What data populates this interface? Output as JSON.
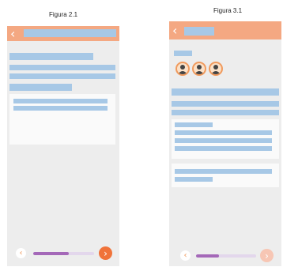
{
  "captions": {
    "left": "Figura 2.1",
    "right": "Figura 3.1"
  },
  "icons": {
    "back": "‹",
    "next": "›",
    "prev": "‹"
  },
  "colors": {
    "header": "#f4a882",
    "placeholder": "#a7c8e6",
    "progress": "#a468b8",
    "next_button_active": "#f0733a",
    "next_button_disabled": "#f7c6b4",
    "screen_background": "#ededed"
  },
  "screen_1": {
    "progress_fraction": 0.58
  },
  "screen_2": {
    "progress_fraction": 0.38,
    "avatar_count": 3
  }
}
